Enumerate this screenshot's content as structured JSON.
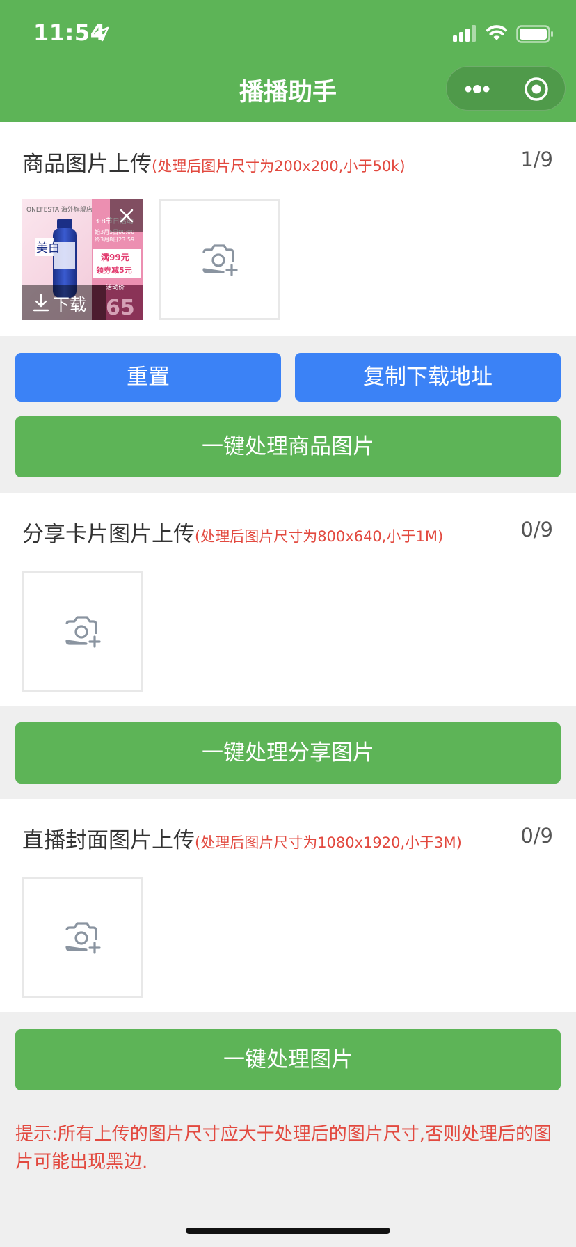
{
  "status_bar": {
    "time": "11:54"
  },
  "nav": {
    "title": "播播助手"
  },
  "sections": [
    {
      "title": "商品图片上传",
      "hint": "(处理后图片尺寸为200x200,小于50k)",
      "count": "1/9"
    },
    {
      "title": "分享卡片图片上传",
      "hint": "(处理后图片尺寸为800x640,小于1M)",
      "count": "0/9"
    },
    {
      "title": "直播封面图片上传",
      "hint": "(处理后图片尺寸为1080x1920,小于3M)",
      "count": "0/9"
    }
  ],
  "thumbnail": {
    "download_label": "下载",
    "product_image_text": {
      "store": "ONEFESTA 海外旗舰店",
      "event": "3·8节日活动",
      "date_line_1": "始3月5日00:00",
      "date_line_2": "终3月8日23:59",
      "coupon_line_1": "满99元",
      "coupon_line_2": "领券减5元",
      "price_label": "活动价",
      "price": "65",
      "product_text": "美白"
    }
  },
  "buttons": {
    "reset": "重置",
    "copy_url": "复制下载地址",
    "process_product": "一键处理商品图片",
    "process_share": "一键处理分享图片",
    "process_all": "一键处理图片"
  },
  "tip": "提示:所有上传的图片尺寸应大于处理后的图片尺寸,否则处理后的图片可能出现黑边.",
  "colors": {
    "primary_green": "#5db457",
    "primary_blue": "#3b82f6",
    "hint_red": "#e2493f"
  }
}
